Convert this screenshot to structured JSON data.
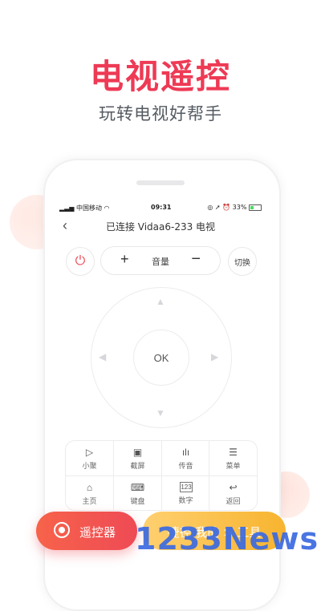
{
  "headline": "电视遥控",
  "subheadline": "玩转电视好帮手",
  "phone": {
    "status": {
      "carrier": "中国移动",
      "time": "09:31",
      "battery": "33%"
    },
    "nav": {
      "back_icon": "chevron-left-icon",
      "title": "已连接 Vidaa6-233 电视"
    },
    "controls": {
      "power_icon": "power-icon",
      "volume_plus": "+",
      "volume_label": "音量",
      "volume_minus": "−",
      "switch_label": "切换"
    },
    "dpad": {
      "ok_label": "OK"
    },
    "grid": [
      {
        "label": "小聚",
        "icon": "play-icon",
        "glyph": "▷"
      },
      {
        "label": "截屏",
        "icon": "screenshot-icon",
        "glyph": "▣"
      },
      {
        "label": "传音",
        "icon": "audio-wave-icon",
        "glyph": "ılı"
      },
      {
        "label": "菜单",
        "icon": "menu-icon",
        "glyph": "☰"
      },
      {
        "label": "主页",
        "icon": "home-icon",
        "glyph": "⌂"
      },
      {
        "label": "键盘",
        "icon": "keyboard-icon",
        "glyph": "⌨"
      },
      {
        "label": "数字",
        "icon": "number-pad-icon",
        "glyph": "123"
      },
      {
        "label": "返回",
        "icon": "return-icon",
        "glyph": "↩"
      }
    ]
  },
  "bottom": {
    "remote_label": "遥控器",
    "shortcut_label": "捷径 我的 > 工具"
  },
  "watermark": "1233News",
  "colors": {
    "accent": "#ee3a55",
    "orange_gradient": "#f7634a",
    "yellow_button": "#f7b42f",
    "watermark": "#3b6ae0"
  }
}
